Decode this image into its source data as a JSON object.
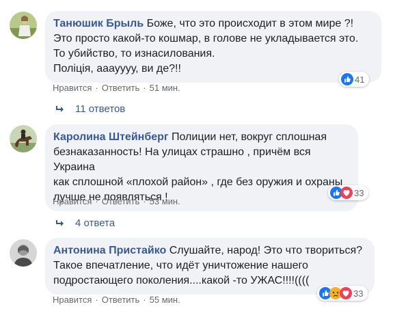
{
  "comments": [
    {
      "author": "Танюшик Брыль",
      "lines": [
        "Боже, что это происходит в этом мире ?!",
        "Это просто какой-то кошмар, в голове не укладывается это.",
        "То убийство, то изнасилования.",
        "Поліція, ааауууу, ви де?!!"
      ],
      "like_label": "Нравится",
      "reply_label": "Ответить",
      "time": "51 мин.",
      "reaction_icons": [
        "like-icon"
      ],
      "reaction_count": "41",
      "replies_label": "11 ответов"
    },
    {
      "author": "Каролина Штейнберг",
      "lines": [
        "Полиции нет, вокруг сплошная",
        "безнаказанность! На улицах страшно , причём вся Украина",
        "как сплошной «плохой район» , где без оружия и охраны",
        "лучше не появляться !"
      ],
      "like_label": "Нравится",
      "reply_label": "Ответить",
      "time": "53 мин.",
      "reaction_icons": [
        "like-icon",
        "love-icon"
      ],
      "reaction_count": "33",
      "replies_label": "4 ответа"
    },
    {
      "author": "Антонина Пристайко",
      "lines": [
        "Слушайте, народ! Это что твориться?",
        "Такое впечатление, что идёт уничтожение нашего",
        "подростающего поколения....какой -то УЖАС!!!!(((("
      ],
      "like_label": "Нравится",
      "reply_label": "Ответить",
      "time": "55 мин.",
      "reaction_icons": [
        "like-icon",
        "sad-icon",
        "love-icon"
      ],
      "reaction_count": "33"
    }
  ],
  "colors": {
    "like": "#1877f2",
    "love": "#f33e58",
    "sad": "#f7b125",
    "author": "#385898",
    "meta": "#65676b",
    "bubble": "#f0f2f5"
  }
}
